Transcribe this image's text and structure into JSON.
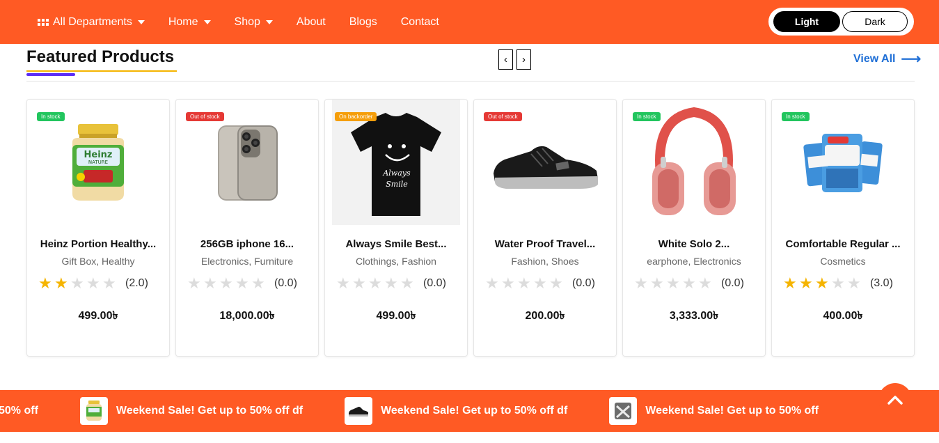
{
  "nav": {
    "all_departments": "All Departments",
    "home": "Home",
    "shop": "Shop",
    "about": "About",
    "blogs": "Blogs",
    "contact": "Contact"
  },
  "theme": {
    "light": "Light",
    "dark": "Dark"
  },
  "section": {
    "title": "Featured Products",
    "view_all": "View All",
    "prev": "‹",
    "next": "›"
  },
  "products": [
    {
      "badge": "In stock",
      "badge_color": "#22c55e",
      "name": "Heinz Portion Healthy...",
      "category": "Gift Box, Healthy",
      "rating": 2,
      "rating_text": "(2.0)",
      "price": "499.00৳",
      "image_icon": "baby-food-jar-icon"
    },
    {
      "badge": "Out of stock",
      "badge_color": "#e53935",
      "name": "256GB iphone 16...",
      "category": "Electronics, Furniture",
      "rating": 0,
      "rating_text": "(0.0)",
      "price": "18,000.00৳",
      "image_icon": "smartphone-icon"
    },
    {
      "badge": "On backorder",
      "badge_color": "#f59e0b",
      "name": "Always Smile Best...",
      "category": "Clothings, Fashion",
      "rating": 0,
      "rating_text": "(0.0)",
      "price": "499.00৳",
      "image_icon": "tshirt-icon"
    },
    {
      "badge": "Out of stock",
      "badge_color": "#e53935",
      "name": "Water Proof Travel...",
      "category": "Fashion, Shoes",
      "rating": 0,
      "rating_text": "(0.0)",
      "price": "200.00৳",
      "image_icon": "sneaker-icon"
    },
    {
      "badge": "In stock",
      "badge_color": "#22c55e",
      "name": "White Solo 2...",
      "category": "earphone, Electronics",
      "rating": 0,
      "rating_text": "(0.0)",
      "price": "3,333.00৳",
      "image_icon": "headphones-icon"
    },
    {
      "badge": "In stock",
      "badge_color": "#22c55e",
      "name": "Comfortable Regular ...",
      "category": "Cosmetics",
      "rating": 3,
      "rating_text": "(3.0)",
      "price": "400.00৳",
      "image_icon": "cheese-pack-icon"
    }
  ],
  "ticker": {
    "lead_fragment": "50% off",
    "items": [
      {
        "text": "Weekend Sale! Get up to 50% off df",
        "icon": "baby-food-jar-icon"
      },
      {
        "text": "Weekend Sale! Get up to 50% off df",
        "icon": "sneaker-icon"
      },
      {
        "text": "Weekend Sale! Get up to 50% off",
        "icon": "product-thumb-icon"
      }
    ]
  },
  "colors": {
    "brand": "#ff5a24",
    "link": "#1f6fd6",
    "star": "#f5b400"
  }
}
